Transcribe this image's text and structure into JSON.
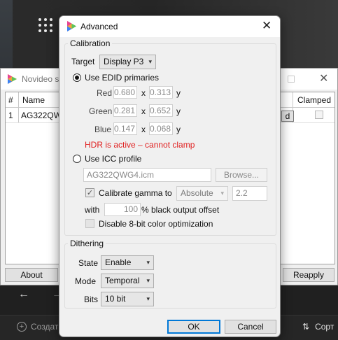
{
  "back_window": {
    "title": "Novideo s",
    "columns": [
      "#",
      "Name",
      "Clamped"
    ],
    "rows": [
      {
        "index": "1",
        "name": "AG322QW",
        "button_fragment": "d",
        "clamped": false
      }
    ],
    "about_label": "About",
    "reapply_label": "Reapply"
  },
  "taskbar": {
    "create_label": "Создат",
    "sort_label": "Сорт"
  },
  "dialog": {
    "title": "Advanced",
    "calibration": {
      "legend": "Calibration",
      "target_label": "Target",
      "target_value": "Display P3",
      "edid_label": "Use EDID primaries",
      "edid_selected": true,
      "primaries": [
        {
          "name": "Red",
          "x": "0.680",
          "y": "0.313"
        },
        {
          "name": "Green",
          "x": "0.281",
          "y": "0.652"
        },
        {
          "name": "Blue",
          "x": "0.147",
          "y": "0.068"
        }
      ],
      "x_label": "x",
      "y_label": "y",
      "hdr_warning": "HDR is active – cannot clamp",
      "icc_label": "Use ICC profile",
      "icc_selected": false,
      "icc_path": "AG322QWG4.icm",
      "browse_label": "Browse...",
      "calibrate_gamma_label": "Calibrate gamma to",
      "calibrate_gamma_checked": true,
      "gamma_mode": "Absolute",
      "gamma_value": "2.2",
      "with_label": "with",
      "black_offset_value": "100",
      "black_offset_label": "% black output offset",
      "disable_8bit_label": "Disable 8-bit color optimization",
      "disable_8bit_checked": false
    },
    "dithering": {
      "legend": "Dithering",
      "state_label": "State",
      "state_value": "Enable",
      "mode_label": "Mode",
      "mode_value": "Temporal",
      "bits_label": "Bits",
      "bits_value": "10 bit"
    },
    "ok_label": "OK",
    "cancel_label": "Cancel"
  },
  "colors": {
    "error": "#e02020",
    "accent": "#0078d7"
  }
}
